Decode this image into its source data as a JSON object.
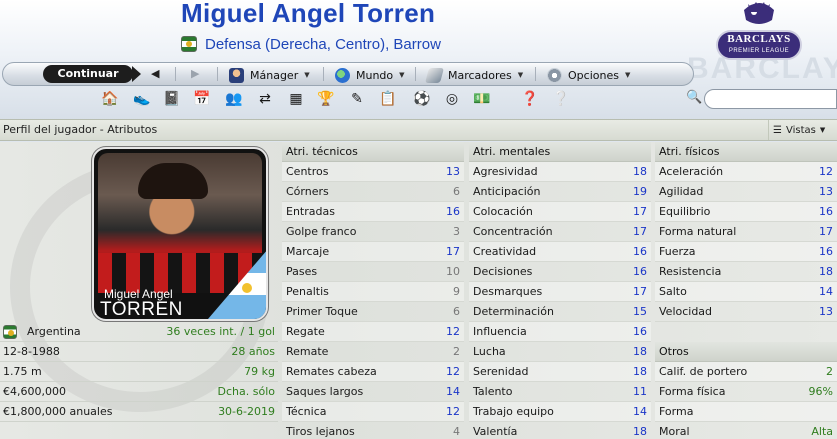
{
  "header": {
    "player_name": "Miguel Angel Torren",
    "position_club": "Defensa (Derecha, Centro), Barrow",
    "league_logo": {
      "line1": "BARCLAYS",
      "line2": "PREMIER LEAGUE"
    },
    "background_text": "BARCLAYS"
  },
  "nav": {
    "continue_label": "Continuar",
    "menus": [
      {
        "label": "Mánager",
        "icon": "manager-icon"
      },
      {
        "label": "Mundo",
        "icon": "globe-icon"
      },
      {
        "label": "Marcadores",
        "icon": "bookmark-icon"
      },
      {
        "label": "Opciones",
        "icon": "options-icon"
      }
    ]
  },
  "toolbar_icons": [
    "home-icon",
    "shoe-icon",
    "notebook-icon",
    "calendar-icon",
    "team-icon",
    "transfer-icon",
    "scoreboard-icon",
    "trophy-icon",
    "tactics-icon",
    "clipboard-icon",
    "ball-icon",
    "binoculars-icon",
    "money-icon",
    "help-icon",
    "question-icon"
  ],
  "search": {
    "placeholder": ""
  },
  "titlebar": {
    "title": "Perfil del jugador - Atributos",
    "views_label": "Vistas"
  },
  "player_card": {
    "first_name": "Miguel  Angel",
    "last_name": "TORREN"
  },
  "info": [
    {
      "left": "Argentina",
      "right": "36 veces int. / 1 gol",
      "flag": true
    },
    {
      "left": "12-8-1988",
      "right": "28 años"
    },
    {
      "left": "1.75 m",
      "right": "79 kg"
    },
    {
      "left": "€4,600,000",
      "right": "Dcha. sólo"
    },
    {
      "left": "€1,800,000 anuales",
      "right": "30-6-2019"
    }
  ],
  "technical": {
    "header": "Atri. técnicos",
    "rows": [
      {
        "name": "Centros",
        "value": "13"
      },
      {
        "name": "Córners",
        "value": "6"
      },
      {
        "name": "Entradas",
        "value": "16"
      },
      {
        "name": "Golpe franco",
        "value": "3"
      },
      {
        "name": "Marcaje",
        "value": "17"
      },
      {
        "name": "Pases",
        "value": "10"
      },
      {
        "name": "Penaltis",
        "value": "9"
      },
      {
        "name": "Primer Toque",
        "value": "6"
      },
      {
        "name": "Regate",
        "value": "12"
      },
      {
        "name": "Remate",
        "value": "2"
      },
      {
        "name": "Remates cabeza",
        "value": "12"
      },
      {
        "name": "Saques largos",
        "value": "14"
      },
      {
        "name": "Técnica",
        "value": "12"
      },
      {
        "name": "Tiros lejanos",
        "value": "4"
      }
    ]
  },
  "mental": {
    "header": "Atri. mentales",
    "rows": [
      {
        "name": "Agresividad",
        "value": "18"
      },
      {
        "name": "Anticipación",
        "value": "19"
      },
      {
        "name": "Colocación",
        "value": "17"
      },
      {
        "name": "Concentración",
        "value": "17"
      },
      {
        "name": "Creatividad",
        "value": "16"
      },
      {
        "name": "Decisiones",
        "value": "16"
      },
      {
        "name": "Desmarques",
        "value": "17"
      },
      {
        "name": "Determinación",
        "value": "15"
      },
      {
        "name": "Influencia",
        "value": "16"
      },
      {
        "name": "Lucha",
        "value": "18"
      },
      {
        "name": "Serenidad",
        "value": "18"
      },
      {
        "name": "Talento",
        "value": "11"
      },
      {
        "name": "Trabajo equipo",
        "value": "14"
      },
      {
        "name": "Valentía",
        "value": "18"
      }
    ]
  },
  "physical": {
    "header": "Atri. físicos",
    "rows": [
      {
        "name": "Aceleración",
        "value": "12"
      },
      {
        "name": "Agilidad",
        "value": "13"
      },
      {
        "name": "Equilibrio",
        "value": "16"
      },
      {
        "name": "Forma natural",
        "value": "17"
      },
      {
        "name": "Fuerza",
        "value": "16"
      },
      {
        "name": "Resistencia",
        "value": "18"
      },
      {
        "name": "Salto",
        "value": "14"
      },
      {
        "name": "Velocidad",
        "value": "13"
      }
    ]
  },
  "others": {
    "header": "Otros",
    "rows": [
      {
        "name": "Calif. de portero",
        "value": "2"
      },
      {
        "name": "Forma física",
        "value": "96%"
      },
      {
        "name": "Forma",
        "value": ""
      },
      {
        "name": "Moral",
        "value": "Alta"
      }
    ]
  },
  "colors": {
    "title_blue": "#1f46b8",
    "value_blue": "#1a35c8",
    "value_green": "#2f7d1e",
    "value_grey": "#777777"
  }
}
